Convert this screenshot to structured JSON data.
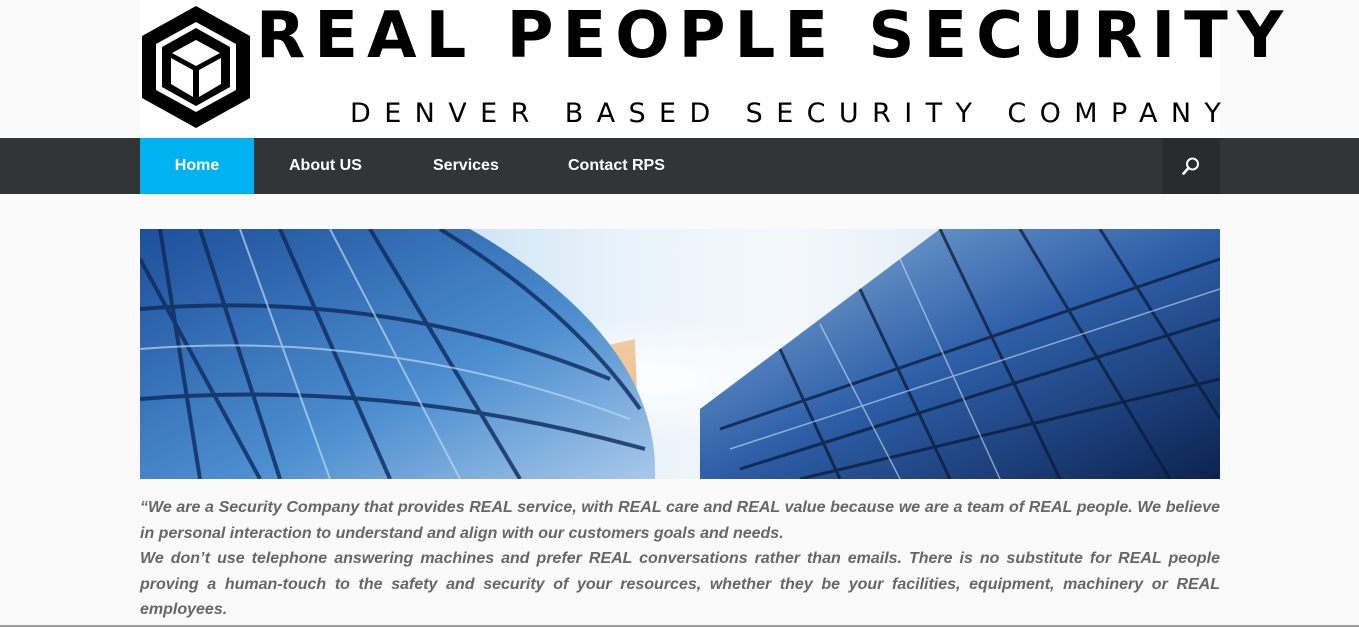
{
  "brand": {
    "title": "REAL PEOPLE SECURITY",
    "tagline": "DENVER BASED SECURITY COMPANY"
  },
  "nav": {
    "items": [
      {
        "label": "Home",
        "active": true
      },
      {
        "label": "About US",
        "active": false
      },
      {
        "label": "Services",
        "active": false
      },
      {
        "label": "Contact RPS",
        "active": false
      }
    ],
    "search_icon": "search-icon"
  },
  "colors": {
    "nav_background": "#333438",
    "nav_active": "#00b3f0",
    "quote_text": "#666666"
  },
  "hero": {
    "icon": "satellite-dish-and-glass-building-photo"
  },
  "intro": {
    "paragraph_1": "“We are a Security Company that provides REAL service, with REAL care and REAL value because we are a team of REAL people. We believe in personal interaction to understand and align with our customers goals and needs.",
    "paragraph_2": "We don’t use telephone answering machines and prefer REAL conversations rather than emails. There is no substitute for REAL people proving a human-touch to the safety and security of your resources, whether they be your facilities, equipment, machinery or REAL employees."
  }
}
